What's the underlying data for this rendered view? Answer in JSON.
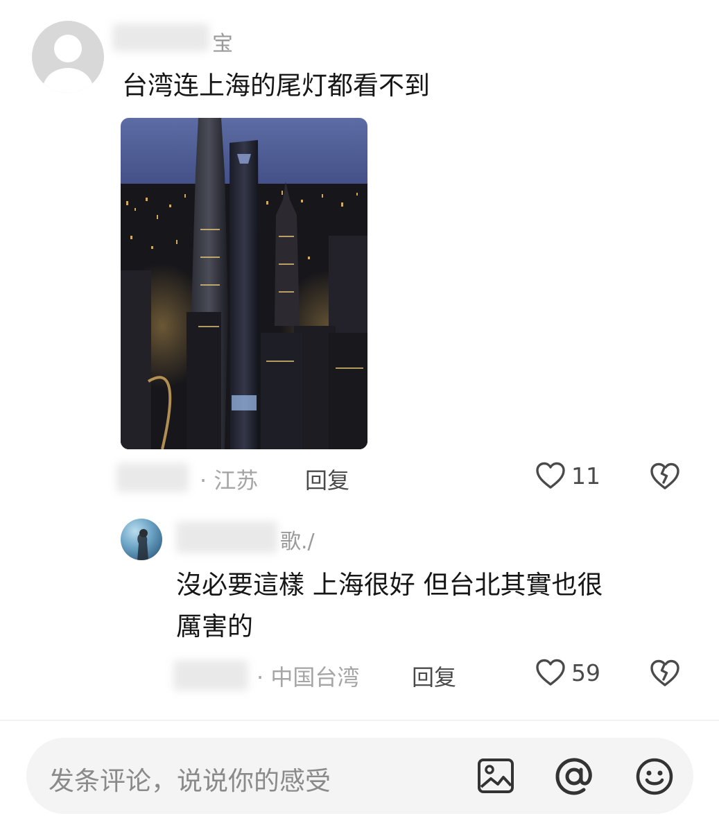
{
  "comments": [
    {
      "username_suffix": "宝",
      "text": "台湾连上海的尾灯都看不到",
      "location": "· 江苏",
      "reply_label": "回复",
      "like_count": "11"
    }
  ],
  "reply": {
    "username_suffix": "歌./",
    "text_line1": "沒必要這樣 上海很好 但台北其實也很",
    "text_line2": "厲害的",
    "location": "· 中国台湾",
    "reply_label": "回复",
    "like_count": "59"
  },
  "composer": {
    "placeholder": "发条评论，说说你的感受"
  },
  "icons": {
    "like": "heart-outline-icon",
    "dislike": "broken-heart-icon",
    "image": "image-icon",
    "mention": "at-sign-icon",
    "emoji": "emoji-icon"
  }
}
